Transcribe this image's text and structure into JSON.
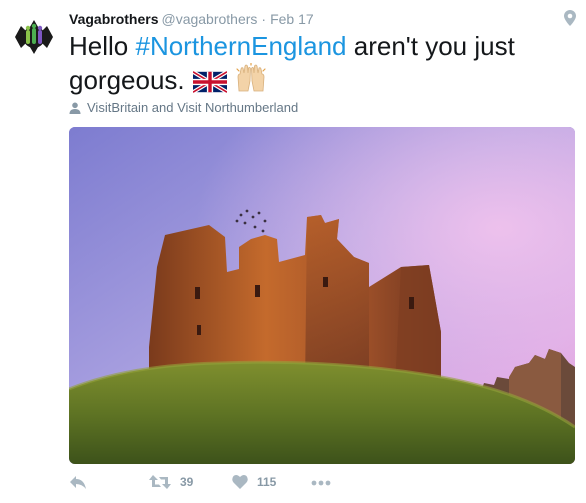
{
  "tweet": {
    "display_name": "Vagabrothers",
    "handle": "@vagabrothers",
    "separator": "·",
    "timestamp": "Feb 17",
    "text_before": "Hello ",
    "hashtag": "#NorthernEngland",
    "text_after": " aren't you just gorgeous.",
    "tagged_users": "VisitBritain and Visit Northumberland",
    "retweet_count": "39",
    "like_count": "115"
  },
  "icons": {
    "location": "location-pin-icon",
    "tagged": "person-icon",
    "reply": "reply-icon",
    "retweet": "retweet-icon",
    "like": "heart-icon",
    "more": "more-icon",
    "flag": "union-jack-flag-emoji",
    "hands": "raised-hands-emoji"
  },
  "colors": {
    "hashtag": "#1b95e0",
    "muted": "#8899a6",
    "text": "#14171a"
  }
}
